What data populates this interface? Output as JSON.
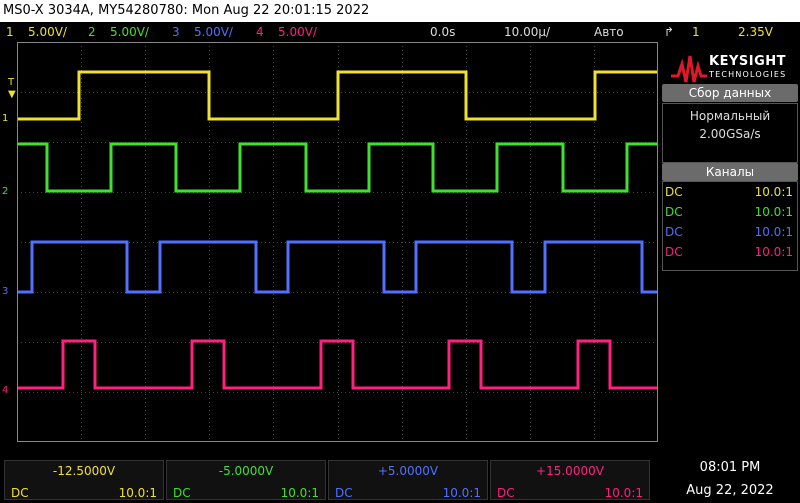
{
  "title": "MS0-X 3034A, MY54280780: Mon Aug 22 20:01:15 2022",
  "status": {
    "channels": [
      {
        "num": "1",
        "scale": "5.00V/",
        "color": "#f0e030"
      },
      {
        "num": "2",
        "scale": "5.00V/",
        "color": "#40e030"
      },
      {
        "num": "3",
        "scale": "5.00V/",
        "color": "#5070ff"
      },
      {
        "num": "4",
        "scale": "5.00V/",
        "color": "#ff2080"
      }
    ],
    "delay": "0.0s",
    "timebase": "10.00µ/",
    "trigger_mode": "Авто",
    "trigger_source": "1",
    "trigger_level": "2.35V"
  },
  "markers": {
    "trigger": "T",
    "ch1": "1",
    "ch2": "2",
    "ch3": "3",
    "ch4": "4"
  },
  "logo": {
    "brand": "KEYSIGHT",
    "sub": "TECHNOLOGIES"
  },
  "acquisition": {
    "header": "Сбор данных",
    "mode": "Нормальный",
    "rate": "2.00GSa/s"
  },
  "channels_panel": {
    "header": "Каналы",
    "rows": [
      {
        "coupling": "DC",
        "probe": "10.0:1",
        "color": "#f0e030"
      },
      {
        "coupling": "DC",
        "probe": "10.0:1",
        "color": "#40e030"
      },
      {
        "coupling": "DC",
        "probe": "10.0:1",
        "color": "#5070ff"
      },
      {
        "coupling": "DC",
        "probe": "10.0:1",
        "color": "#ff2080"
      }
    ]
  },
  "offsets": [
    {
      "offset": "-12.5000V",
      "coupling": "DC",
      "probe": "10.0:1",
      "color": "#f0e030"
    },
    {
      "offset": "-5.0000V",
      "coupling": "DC",
      "probe": "10.0:1",
      "color": "#40e030"
    },
    {
      "offset": "+5.0000V",
      "coupling": "DC",
      "probe": "10.0:1",
      "color": "#5070ff"
    },
    {
      "offset": "+15.0000V",
      "coupling": "DC",
      "probe": "10.0:1",
      "color": "#ff2080"
    }
  ],
  "clock": {
    "time": "08:01 PM",
    "date": "Aug 22, 2022"
  }
}
